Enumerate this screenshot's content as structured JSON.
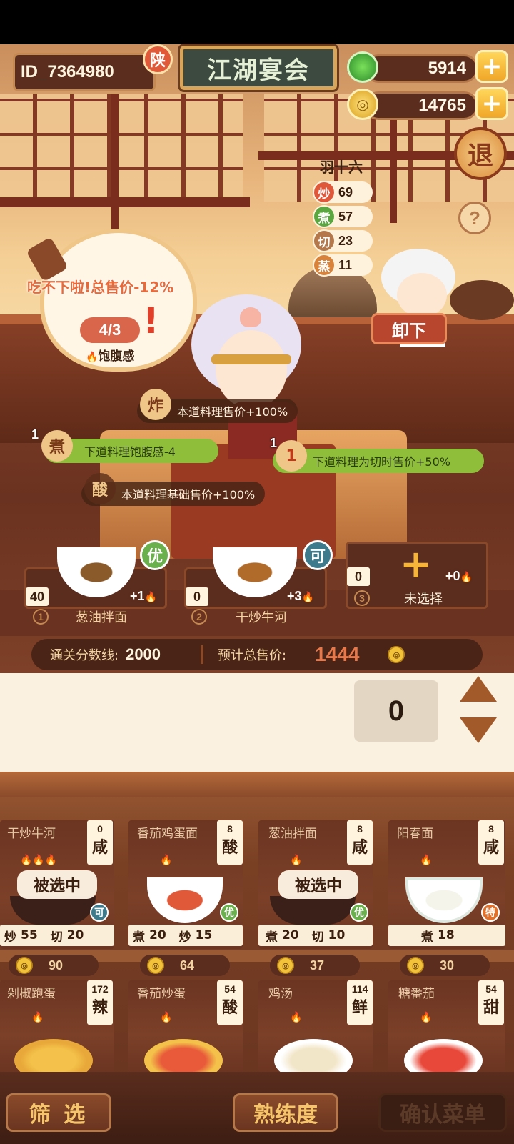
{
  "header": {
    "player_id": "ID_7364980",
    "region_badge": "陕",
    "title": "江湖宴会",
    "jade": "5914",
    "coins": "14765",
    "exit_label": "退",
    "help_label": "?"
  },
  "chef": {
    "name": "羽十六",
    "stats": [
      {
        "icon": "炒",
        "value": "69",
        "color": "#e0583a"
      },
      {
        "icon": "煮",
        "value": "57",
        "color": "#5aa640"
      },
      {
        "icon": "切",
        "value": "23",
        "color": "#b5784a"
      },
      {
        "icon": "蒸",
        "value": "11",
        "color": "#d9823a"
      }
    ],
    "unload_label": "卸下"
  },
  "guest": {
    "warning": "吃不下啦!总售价-12%",
    "fullness": "4/3",
    "fullness_label": "饱腹感"
  },
  "effects": [
    {
      "icon": "炸",
      "num": "",
      "text": "本道料理售价+100%"
    },
    {
      "icon": "煮",
      "num": "1",
      "text": "下道料理饱腹感-4"
    },
    {
      "icon": "1",
      "num": "1",
      "text": "下道料理为切时售价+50%"
    },
    {
      "icon": "酸",
      "num": "",
      "text": "本道料理基础售价+100%"
    }
  ],
  "slots": [
    {
      "num": "1",
      "name": "葱油拌面",
      "count": "40",
      "bonus": "+1",
      "grade": "优"
    },
    {
      "num": "2",
      "name": "干炒牛河",
      "count": "0",
      "bonus": "+3",
      "grade": "可"
    },
    {
      "num": "3",
      "name": "未选择",
      "count": "0",
      "bonus": "+0",
      "grade": ""
    }
  ],
  "score": {
    "threshold_label": "通关分数线:",
    "threshold": "2000",
    "total_label": "预计总售价:",
    "total": "1444"
  },
  "quantity": "0",
  "dishes": [
    {
      "name": "干炒牛河",
      "count": "0",
      "flavor": "咸",
      "flames": "🔥🔥🔥",
      "grade": "可",
      "selected": "被选中",
      "req": [
        [
          "炒",
          "55"
        ],
        [
          "切",
          "20"
        ]
      ],
      "price": "90"
    },
    {
      "name": "番茄鸡蛋面",
      "count": "8",
      "flavor": "酸",
      "flames": "🔥",
      "grade": "优",
      "selected": "",
      "req": [
        [
          "煮",
          "20"
        ],
        [
          "炒",
          "15"
        ]
      ],
      "price": "64"
    },
    {
      "name": "葱油拌面",
      "count": "8",
      "flavor": "咸",
      "flames": "🔥",
      "grade": "优",
      "selected": "被选中",
      "req": [
        [
          "煮",
          "20"
        ],
        [
          "切",
          "10"
        ]
      ],
      "price": "37"
    },
    {
      "name": "阳春面",
      "count": "8",
      "flavor": "咸",
      "flames": "🔥",
      "grade": "特",
      "selected": "",
      "req": [
        [
          "煮",
          "18"
        ]
      ],
      "price": "30"
    },
    {
      "name": "剁椒跑蛋",
      "count": "172",
      "flavor": "辣",
      "flames": "🔥",
      "grade": "",
      "selected": "",
      "req": [],
      "price": ""
    },
    {
      "name": "番茄炒蛋",
      "count": "54",
      "flavor": "酸",
      "flames": "🔥",
      "grade": "",
      "selected": "",
      "req": [],
      "price": ""
    },
    {
      "name": "鸡汤",
      "count": "114",
      "flavor": "鲜",
      "flames": "🔥",
      "grade": "",
      "selected": "",
      "req": [],
      "price": ""
    },
    {
      "name": "糖番茄",
      "count": "54",
      "flavor": "甜",
      "flames": "🔥",
      "grade": "",
      "selected": "",
      "req": [],
      "price": ""
    }
  ],
  "bottom": {
    "filter": "筛 选",
    "proficiency": "熟练度",
    "confirm": "确认菜单"
  },
  "colors": {
    "grade_good": "#6ab04c",
    "grade_ok": "#3d7a8c",
    "grade_special": "#e0702a",
    "accent_gold": "#f0a628",
    "total_red": "#e0583a"
  }
}
